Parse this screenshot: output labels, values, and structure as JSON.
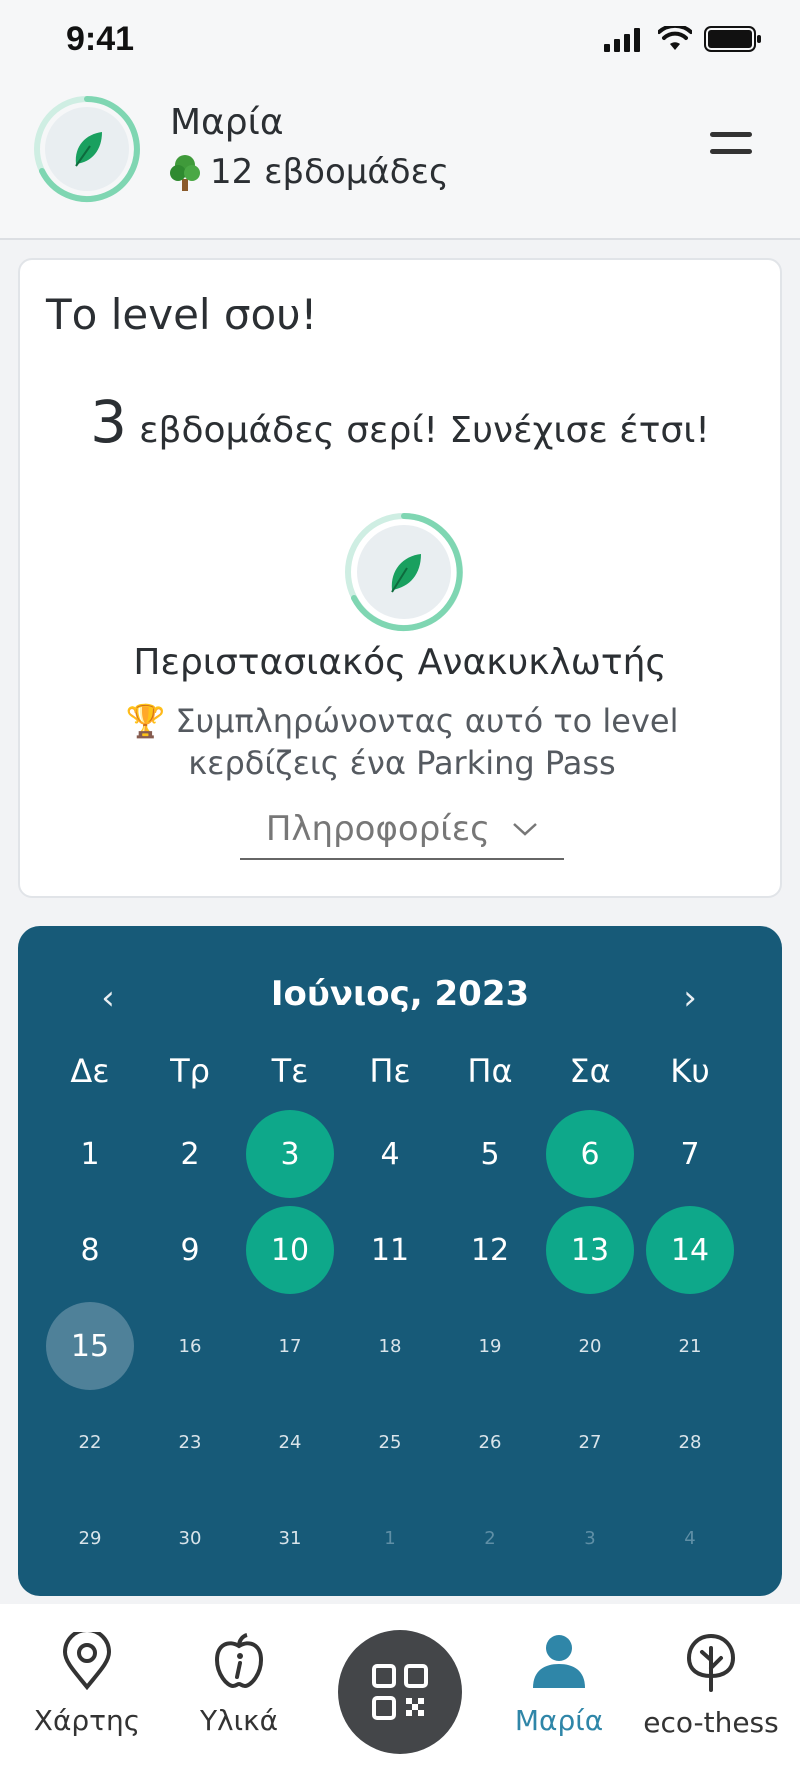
{
  "status": {
    "time": "9:41"
  },
  "header": {
    "user_name": "Μαρία",
    "streak": "12 εβδομάδες"
  },
  "level": {
    "title": "Το level σου!",
    "streak_count": "3",
    "streak_text": "εβδομάδες σερί! Συνέχισε έτσι!",
    "level_name": "Περιστασιακός Ανακυκλωτής",
    "reward_text": "Συμπληρώνοντας αυτό το level κερδίζεις ένα Parking Pass",
    "info_label": "Πληροφορίες"
  },
  "calendar": {
    "month": "Ιούνιος, 2023",
    "prev": "‹",
    "next": "›",
    "weekdays": [
      "Δε",
      "Τρ",
      "Τε",
      "Πε",
      "Πα",
      "Σα",
      "Κυ"
    ],
    "weeks": [
      [
        "1",
        "2",
        "3",
        "4",
        "5",
        "6",
        "7"
      ],
      [
        "8",
        "9",
        "10",
        "11",
        "12",
        "13",
        "14"
      ],
      [
        "15",
        "16",
        "17",
        "18",
        "19",
        "20",
        "21"
      ],
      [
        "22",
        "23",
        "24",
        "25",
        "26",
        "27",
        "28"
      ],
      [
        "29",
        "30",
        "31",
        "1",
        "2",
        "3",
        "4"
      ]
    ],
    "completed_days": [
      "3",
      "6",
      "10",
      "13",
      "14"
    ],
    "today": "15"
  },
  "tabs": [
    {
      "label": "Χάρτης",
      "icon": "map-pin-icon"
    },
    {
      "label": "Υλικά",
      "icon": "apple-info-icon"
    },
    {
      "label": "",
      "icon": "qr-code-icon"
    },
    {
      "label": "Μαρία",
      "icon": "user-icon"
    },
    {
      "label": "eco-thess",
      "icon": "tree-icon"
    }
  ],
  "colors": {
    "accent_green": "#0ea88a",
    "calendar_bg": "#175a78",
    "active_tab": "#2f86a8"
  }
}
